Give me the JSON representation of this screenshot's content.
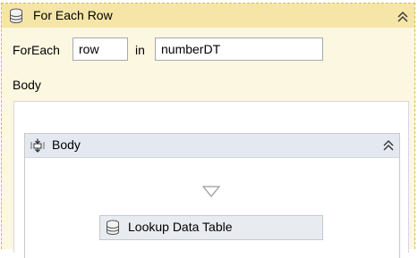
{
  "activity": {
    "title": "For Each Row",
    "foreach_label": "ForEach",
    "in_label": "in",
    "item_variable": "row",
    "collection": "numberDT",
    "body_label": "Body"
  },
  "sequence": {
    "title": "Body",
    "child_activity": "Lookup Data Table"
  },
  "colors": {
    "header_bg": "#f5e6a8",
    "activity_bg": "#fcf7e1",
    "sequence_header_bg": "#e4e9f1",
    "child_activity_bg": "#e8ebef"
  },
  "icons": {
    "activity": "data-table-icon",
    "collapse": "double-chevron-up-icon",
    "sequence": "sequence-icon",
    "drop_target": "drop-arrow-icon",
    "child": "data-table-icon"
  }
}
